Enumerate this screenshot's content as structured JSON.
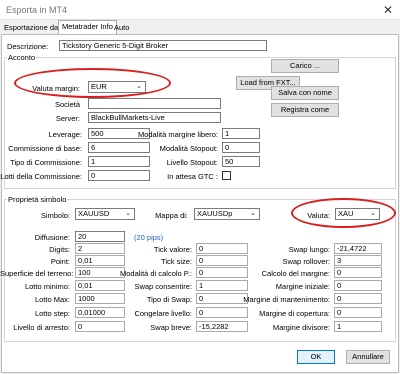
{
  "window": {
    "title": "Esporta in MT4",
    "close_glyph": "✕"
  },
  "tabs": [
    {
      "label": "Esportazione dati"
    },
    {
      "label": "Metatrader Info"
    },
    {
      "label": "Auto"
    }
  ],
  "description": {
    "label": "Descrizione:",
    "value": "Tickstory Generic 5-Digit Broker"
  },
  "account": {
    "group_label": "Acconto",
    "currency": {
      "label": "Valuta margin:",
      "value": "EUR"
    },
    "company": {
      "label": "Società",
      "value": ""
    },
    "server": {
      "label": "Server:",
      "value": "BlackBullMarkets-Live"
    },
    "buttons": {
      "load": "Carico ...",
      "load_fxt": "Load from FXT...",
      "save_as": "Salva con nome",
      "register_as": "Registra come"
    },
    "leverage": {
      "label": "Leverage:",
      "value": "500"
    },
    "base_commission": {
      "label": "Commissione di base:",
      "value": "6"
    },
    "commission_type": {
      "label": "Tipo di Commissione:",
      "value": "1"
    },
    "commission_lots": {
      "label": "Lotti della Commissione:",
      "value": "0"
    },
    "free_margin_mode": {
      "label": "Modalità margine libero:",
      "value": "1"
    },
    "stopout_mode": {
      "label": "Modalità Stopout:",
      "value": "0"
    },
    "stopout_level": {
      "label": "Livello Stopout:",
      "value": "50"
    },
    "gtc_pending": {
      "label": "In attesa GTC :",
      "checked": false
    }
  },
  "symbol": {
    "group_label": "Proprietà simbolo",
    "symbol": {
      "label": "Simbolo:",
      "value": "XAUUSD"
    },
    "mapping": {
      "label": "Mappa di:",
      "value": "XAUUSDp"
    },
    "currency": {
      "label": "Valuta:",
      "value": "XAU"
    },
    "spread": {
      "label": "Diffusione:",
      "value": "20",
      "pips": "(20 pips)"
    },
    "digits": {
      "label": "Digits:",
      "value": "2"
    },
    "point": {
      "label": "Point:",
      "value": "0,01"
    },
    "contract_size": {
      "label": "Superficie del terreno:",
      "value": "100"
    },
    "min_lot": {
      "label": "Lotto minimo:",
      "value": "0,01"
    },
    "max_lot": {
      "label": "Lotto Max:",
      "value": "1000"
    },
    "lot_step": {
      "label": "Lotto step:",
      "value": "0,01000"
    },
    "stop_level": {
      "label": "Livello di arresto:",
      "value": "0"
    },
    "tick_value": {
      "label": "Tick valore:",
      "value": "0"
    },
    "tick_size": {
      "label": "Tick size:",
      "value": "0"
    },
    "profit_calc_mode": {
      "label": "Modalità di calcolo P.:",
      "value": "0"
    },
    "swap_enabled": {
      "label": "Swap consentire:",
      "value": "1"
    },
    "swap_type": {
      "label": "Tipo di Swap:",
      "value": "0"
    },
    "freeze_level": {
      "label": "Congelare livello:",
      "value": "0"
    },
    "swap_short": {
      "label": "Swap breve:",
      "value": "-15,2282"
    },
    "swap_long": {
      "label": "Swap lungo:",
      "value": "-21,4722"
    },
    "swap_rollover": {
      "label": "Swap rollover:",
      "value": "3"
    },
    "margin_calc": {
      "label": "Calcolo del margine:",
      "value": "0"
    },
    "margin_initial": {
      "label": "Margine iniziale:",
      "value": "0"
    },
    "margin_maintenance": {
      "label": "Margine di mantenimento:",
      "value": "0"
    },
    "margin_hedged": {
      "label": "Margine di copertura:",
      "value": "0"
    },
    "margin_divider": {
      "label": "Margine divisore:",
      "value": "1"
    }
  },
  "footer": {
    "ok": "OK",
    "cancel": "Annullare"
  },
  "colors": {
    "highlight_oval": "#d81e1e",
    "link": "#1f5fbf",
    "default_button_border": "#0078d7"
  }
}
